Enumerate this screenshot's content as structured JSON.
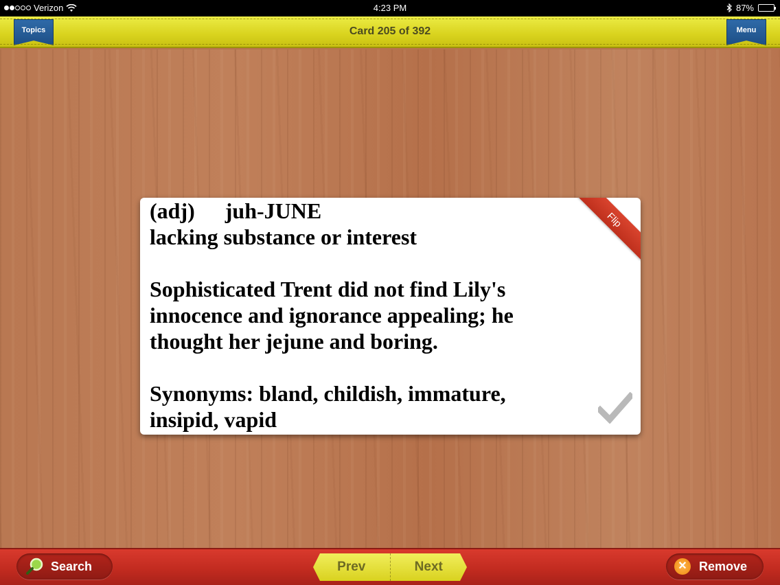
{
  "status_bar": {
    "carrier": "Verizon",
    "time": "4:23 PM",
    "battery": "87%",
    "battery_level": 0.87
  },
  "header": {
    "title": "Card 205 of 392",
    "topics_label": "Topics",
    "menu_label": "Menu"
  },
  "card": {
    "part_of_speech": "(adj)",
    "pronunciation": "juh-JUNE",
    "definition": "lacking substance or interest",
    "example_line1": "Sophisticated Trent did not find Lily's",
    "example_line2": "innocence and ignorance appealing; he",
    "example_line3": "thought her jejune and boring.",
    "synonyms_line1": "Synonyms: bland, childish, immature,",
    "synonyms_line2": "insipid, vapid",
    "flip_label": "Flip"
  },
  "footer": {
    "search_label": "Search",
    "prev_label": "Prev",
    "next_label": "Next",
    "remove_label": "Remove"
  },
  "icons": {
    "search": "search-icon",
    "remove": "close-icon",
    "check": "check-icon",
    "wifi": "wifi-icon",
    "bluetooth": "bluetooth-icon"
  }
}
